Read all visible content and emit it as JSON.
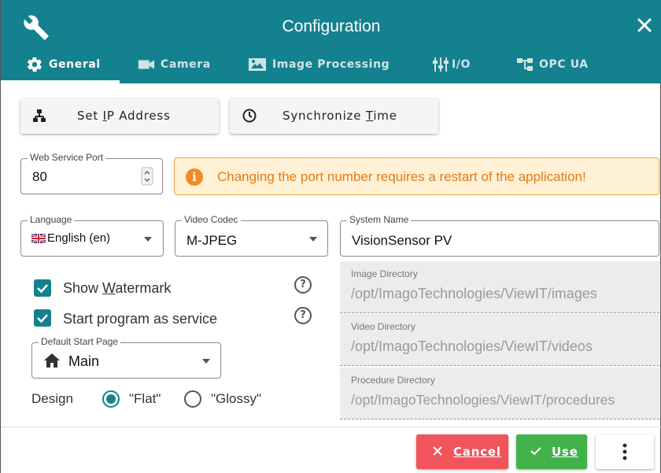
{
  "window": {
    "title": "Configuration"
  },
  "tabs": [
    {
      "label": "General",
      "icon": "gear-icon",
      "active": true
    },
    {
      "label": "Camera",
      "icon": "video-camera-icon",
      "active": false
    },
    {
      "label": "Image Processing",
      "icon": "image-processing-icon",
      "active": false
    },
    {
      "label": "I/O",
      "icon": "io-icon",
      "active": false
    },
    {
      "label": "OPC UA",
      "icon": "opc-ua-icon",
      "active": false
    }
  ],
  "actions": {
    "set_ip": {
      "label_pre": "Set ",
      "label_ul": "I",
      "label_post": "P Address",
      "icon": "network-icon"
    },
    "sync_time": {
      "label_pre": "Synchronize ",
      "label_ul": "T",
      "label_post": "ime",
      "icon": "clock-icon"
    }
  },
  "web_service_port": {
    "label": "Web Service Port",
    "value": "80"
  },
  "alert": {
    "text": "Changing the port number requires a restart of the application!",
    "icon": "info-icon"
  },
  "language": {
    "label": "Language",
    "value": "English (en)",
    "flag": "uk-flag-icon"
  },
  "video_codec": {
    "label": "Video Codec",
    "value": "M-JPEG"
  },
  "system_name": {
    "label": "System Name",
    "value": "VisionSensor PV"
  },
  "show_watermark": {
    "label_pre": "Show ",
    "label_ul": "W",
    "label_post": "atermark",
    "checked": true
  },
  "start_as_service": {
    "label": "Start program as service",
    "checked": true
  },
  "default_start_page": {
    "label": "Default Start Page",
    "value": "Main",
    "icon": "home-icon"
  },
  "design": {
    "label": "Design",
    "options": [
      "\"Flat\"",
      "\"Glossy\""
    ],
    "selected": "\"Flat\""
  },
  "image_directory": {
    "label": "Image Directory",
    "value": "/opt/ImagoTechnologies/ViewIT/images"
  },
  "video_directory": {
    "label": "Video Directory",
    "value": "/opt/ImagoTechnologies/ViewIT/videos"
  },
  "procedure_directory": {
    "label": "Procedure Directory",
    "value": "/opt/ImagoTechnologies/ViewIT/procedures"
  },
  "footer": {
    "cancel": {
      "label": "Cancel",
      "color": "#f2545b"
    },
    "use": {
      "label": "Use",
      "color": "#43b14a"
    }
  },
  "colors": {
    "accent": "#14818f",
    "warning": "#f08a24"
  }
}
